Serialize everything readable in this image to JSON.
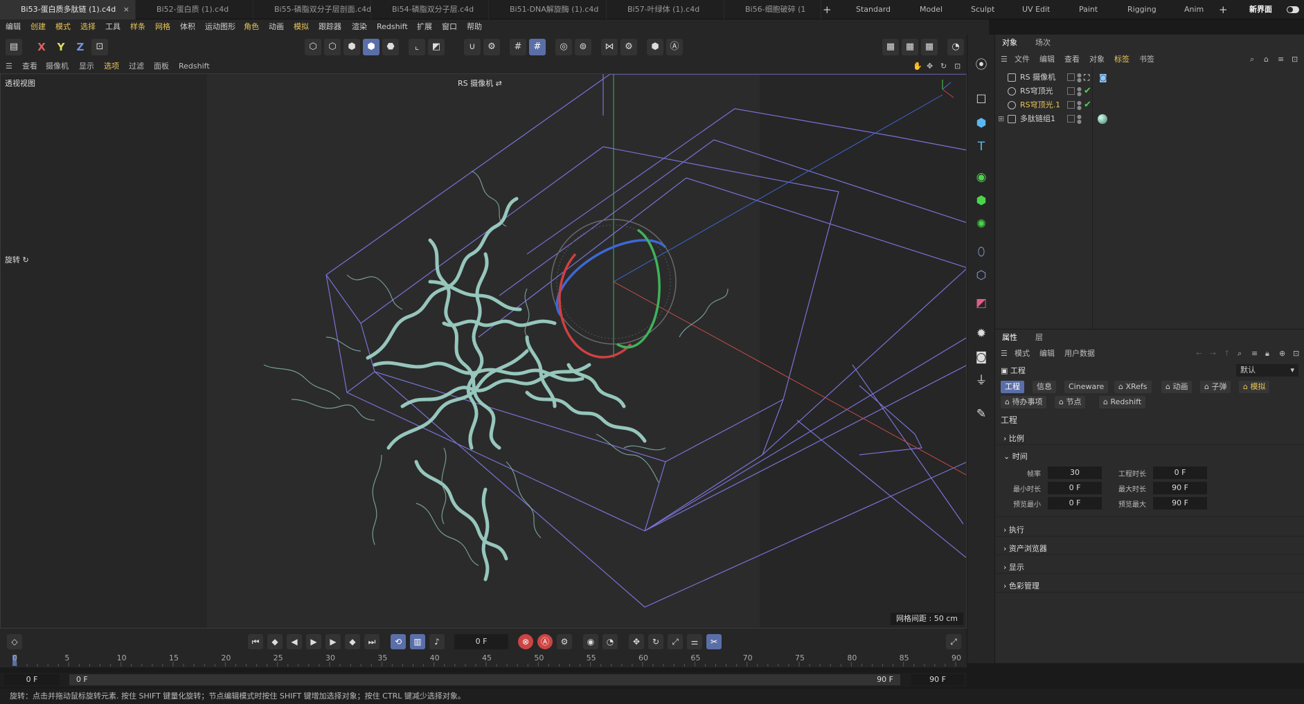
{
  "tabs": [
    {
      "label": "Bi53-蛋白质多肽链 (1).c4d",
      "active": true,
      "close": "×"
    },
    {
      "label": "Bi52-蛋白质 (1).c4d"
    },
    {
      "label": "Bi55-磷脂双分子层剖面.c4d"
    },
    {
      "label": "Bi54-磷脂双分子层.c4d"
    },
    {
      "label": "Bi51-DNA解旋酶 (1).c4d"
    },
    {
      "label": "Bi57-叶绿体 (1).c4d"
    },
    {
      "label": "Bi56-细胞破碎 (1"
    }
  ],
  "tab_plus": "+",
  "layouts": [
    "Standard",
    "Model",
    "Sculpt",
    "UV Edit",
    "Paint",
    "Rigging",
    "Anim"
  ],
  "layout_plus": "+",
  "new_interface": "新界面",
  "menu": [
    "编辑",
    "创建",
    "模式",
    "选择",
    "工具",
    "样条",
    "网格",
    "体积",
    "运动图形",
    "角色",
    "动画",
    "模拟",
    "跟踪器",
    "渲染",
    "Redshift",
    "扩展",
    "窗口",
    "帮助"
  ],
  "toolbar": {
    "x": "X",
    "y": "Y",
    "z": "Z"
  },
  "viewport_menu": [
    "查看",
    "摄像机",
    "显示",
    "选项",
    "过滤",
    "面板",
    "Redshift"
  ],
  "viewport": {
    "label": "透视视图",
    "camera": "RS 摄像机",
    "tool": "旋转",
    "grid_spacing": "网格间距 : 50 cm"
  },
  "object_panel": {
    "tabs": [
      "对象",
      "场次"
    ],
    "menu": [
      "文件",
      "编辑",
      "查看",
      "对象",
      "标签",
      "书签"
    ],
    "objects": [
      {
        "name": "RS 摄像机",
        "tag": "camera"
      },
      {
        "name": "RS穹顶光",
        "tag": "check"
      },
      {
        "name": "RS穹顶光.1",
        "tag": "check",
        "selected": true
      },
      {
        "name": "多肽链组1",
        "tag": "material"
      }
    ]
  },
  "attr_panel": {
    "tabs": [
      "属性",
      "层"
    ],
    "menu": [
      "模式",
      "编辑",
      "用户数据"
    ],
    "title": "工程",
    "preset": "默认",
    "chips_row1": [
      "工程",
      "信息",
      "Cineware",
      "XRefs",
      "动画",
      "子弹",
      "模拟"
    ],
    "chips_row2": [
      "待办事项",
      "节点",
      "Redshift"
    ],
    "section": "工程",
    "groups": [
      "比例",
      "时间",
      "执行",
      "资产浏览器",
      "显示",
      "色彩管理"
    ],
    "fields": [
      {
        "label": "帧率",
        "value": "30"
      },
      {
        "label": "工程时长",
        "value": "0 F"
      },
      {
        "label": "最小时长",
        "value": "0 F"
      },
      {
        "label": "最大时长",
        "value": "90 F"
      },
      {
        "label": "预览最小",
        "value": "0 F"
      },
      {
        "label": "预览最大",
        "value": "90 F"
      }
    ]
  },
  "timeline": {
    "current_frame": "0 F",
    "ticks": [
      "0",
      "5",
      "10",
      "15",
      "20",
      "25",
      "30",
      "35",
      "40",
      "45",
      "50",
      "55",
      "60",
      "65",
      "70",
      "75",
      "80",
      "85",
      "90"
    ],
    "range_start": "0 F",
    "range_start2": "0 F",
    "range_end": "90 F",
    "range_end2": "90 F"
  },
  "status": "旋转：点击并拖动鼠标旋转元素. 按住 SHIFT 键量化旋转；节点编辑模式时按住 SHIFT 键增加选择对象；按住 CTRL 键减少选择对象。",
  "colors": {
    "accent": "#5a6fa8",
    "highlight": "#e8c45a",
    "ribbon": "#9ccfc4",
    "wire": "#7a72d8"
  }
}
